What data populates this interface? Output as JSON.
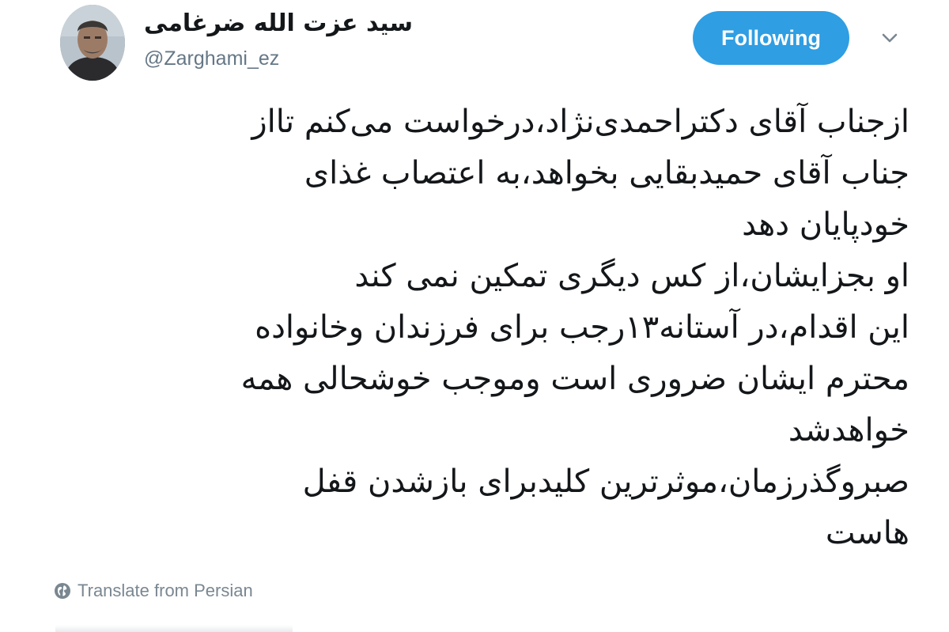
{
  "author": {
    "display_name": "سید عزت الله ضرغامی",
    "handle": "@Zarghami_ez"
  },
  "follow_button": {
    "label": "Following",
    "color": "#2f9ee3"
  },
  "menu": {
    "icon": "chevron-down-icon"
  },
  "tweet": {
    "lines": [
      "ازجناب آقای دکتراحمدی‌نژاد،درخواست می‌کنم تااز",
      "جناب آقای حمیدبقایی بخواهد،به اعتصاب غذای",
      "خودپایان دهد",
      "او بجزایشان،از کس دیگری تمکین نمی کند",
      "این اقدام،در آستانه۱۳رجب برای فرزندان وخانواده",
      "محترم ایشان ضروری است وموجب خوشحالی همه",
      "خواهدشد",
      "صبروگذرزمان،موثرترین کلیدبرای بازشدن قفل",
      "هاست"
    ]
  },
  "translate": {
    "label": "Translate from Persian",
    "icon": "globe-icon"
  }
}
